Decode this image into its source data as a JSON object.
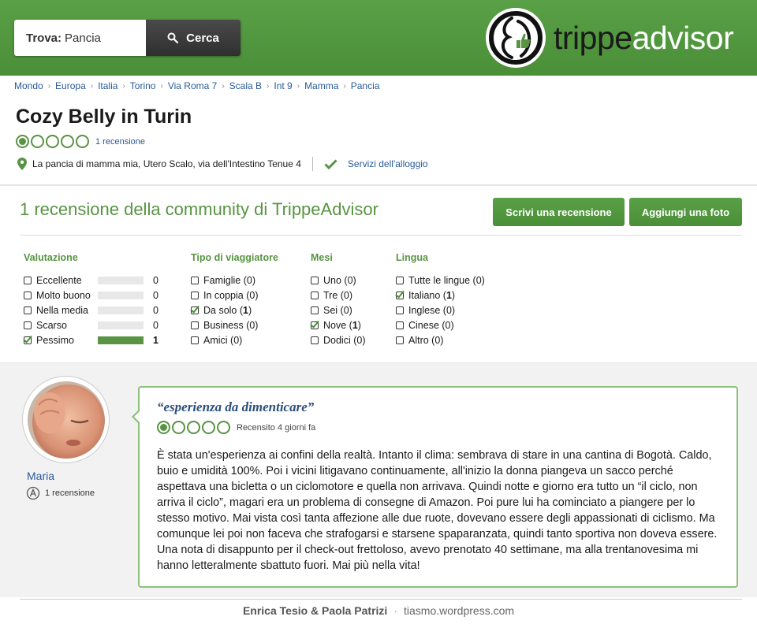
{
  "header": {
    "search_label": "Trova:",
    "search_value": "Pancia",
    "search_button": "Cerca",
    "logo_part1": "trippe",
    "logo_part2": "advisor",
    "logo_icon": "belly-thumbs-up-icon"
  },
  "breadcrumb": [
    "Mondo",
    "Europa",
    "Italia",
    "Torino",
    "Via Roma 7",
    "Scala B",
    "Int 9",
    "Mamma",
    "Pancia"
  ],
  "listing": {
    "title": "Cozy Belly in Turin",
    "rating_bubbles": 1,
    "review_count_link": "1 recensione",
    "address": "La pancia di mamma mia, Utero Scalo, via dell'Intestino Tenue 4",
    "services_link": "Servizi dell'alloggio"
  },
  "reviews_section": {
    "heading": "1 recensione della community di TrippeAdvisor",
    "write_button": "Scrivi una recensione",
    "photo_button": "Aggiungi una foto"
  },
  "filters": {
    "rating": {
      "heading": "Valutazione",
      "items": [
        {
          "label": "Eccellente",
          "count": "0",
          "fraction": 0,
          "checked": false
        },
        {
          "label": "Molto buono",
          "count": "0",
          "fraction": 0,
          "checked": false
        },
        {
          "label": "Nella media",
          "count": "0",
          "fraction": 0,
          "checked": false
        },
        {
          "label": "Scarso",
          "count": "0",
          "fraction": 0,
          "checked": false
        },
        {
          "label": "Pessimo",
          "count": "1",
          "fraction": 1,
          "checked": true
        }
      ]
    },
    "traveler": {
      "heading": "Tipo di viaggiatore",
      "items": [
        {
          "label": "Famiglie (0)",
          "checked": false
        },
        {
          "label": "In coppia (0)",
          "checked": false
        },
        {
          "label": "Da solo (1)",
          "checked": true
        },
        {
          "label": "Business (0)",
          "checked": false
        },
        {
          "label": "Amici (0)",
          "checked": false
        }
      ]
    },
    "months": {
      "heading": "Mesi",
      "items": [
        {
          "label": "Uno (0)",
          "checked": false
        },
        {
          "label": "Tre (0)",
          "checked": false
        },
        {
          "label": "Sei (0)",
          "checked": false
        },
        {
          "label": "Nove (1)",
          "checked": true
        },
        {
          "label": "Dodici (0)",
          "checked": false
        }
      ]
    },
    "language": {
      "heading": "Lingua",
      "items": [
        {
          "label": "Tutte le lingue (0)",
          "checked": false
        },
        {
          "label": "Italiano (1)",
          "checked": true
        },
        {
          "label": "Inglese (0)",
          "checked": false
        },
        {
          "label": "Cinese (0)",
          "checked": false
        },
        {
          "label": "Altro (0)",
          "checked": false
        }
      ]
    }
  },
  "review": {
    "user": "Maria",
    "user_reviews": "1 recensione",
    "title": "“esperienza da dimenticare”",
    "rating_bubbles": 1,
    "date": "Recensito 4 giorni fa",
    "body": "È stata un'esperienza ai confini della realtà. Intanto il clima: sembrava di stare in una cantina di Bogotà. Caldo, buio e umidità 100%. Poi i vicini litigavano continuamente, all'inizio la donna piangeva un sacco perché aspettava una bicletta o un ciclomotore e quella non arrivava. Quindi notte e giorno era tutto un “il ciclo, non arriva il ciclo”, magari era un problema di consegne di Amazon. Poi pure lui ha cominciato a piangere per lo stesso motivo. Mai vista così tanta affezione alle due ruote, dovevano essere degli appassionati di ciclismo. Ma comunque lei poi non faceva che strafogarsi e starsene spaparanzata, quindi tanto sportiva non doveva essere. Una nota di disappunto per il check-out frettoloso, avevo prenotato 40 settimane, ma alla trentanovesima mi hanno letteralmente sbattuto fuori. Mai più nella vita!"
  },
  "footer": {
    "authors": "Enrica Tesio & Paola Patrizi",
    "separator": "·",
    "site": "tiasmo.wordpress.com"
  },
  "colors": {
    "brand_green": "#589442",
    "link_blue": "#2a5a9a"
  }
}
